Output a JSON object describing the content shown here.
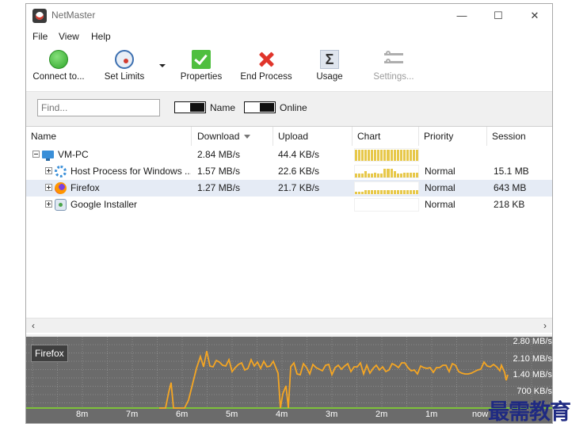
{
  "app": {
    "title": "NetMaster"
  },
  "window_controls": {
    "minimize": "—",
    "maximize": "☐",
    "close": "✕"
  },
  "menu": [
    "File",
    "View",
    "Help"
  ],
  "toolbar": [
    {
      "label": "Connect to...",
      "icon": "connect-icon",
      "enabled": true
    },
    {
      "label": "Set Limits",
      "icon": "gauge-icon",
      "enabled": true
    },
    {
      "label": "Properties",
      "icon": "check-icon",
      "enabled": true
    },
    {
      "label": "End Process",
      "icon": "end-process-icon",
      "enabled": true
    },
    {
      "label": "Usage",
      "icon": "sigma-icon",
      "enabled": true
    },
    {
      "label": "Settings...",
      "icon": "settings-icon",
      "enabled": false
    }
  ],
  "filter": {
    "find_placeholder": "Find...",
    "toggle_name_label": "Name",
    "toggle_online_label": "Online"
  },
  "columns": [
    "Name",
    "Download",
    "Upload",
    "Chart",
    "Priority",
    "Session"
  ],
  "sort": {
    "column": "Download",
    "direction": "descending"
  },
  "rows": [
    {
      "name": "VM-PC",
      "download": "2.84 MB/s",
      "upload": "44.4 KB/s",
      "priority": "",
      "session": "",
      "icon": "pc-icon",
      "level": 0,
      "expander": "minus",
      "selected": false,
      "chart": [
        0.9,
        0.9,
        0.9,
        0.9,
        0.9,
        0.9,
        0.9,
        0.9,
        0.9,
        0.9,
        0.9,
        0.9,
        0.9,
        0.9,
        0.9,
        0.9,
        0.9,
        0.9,
        0.9,
        0.9
      ]
    },
    {
      "name": "Host Process for Windows ...",
      "download": "1.57 MB/s",
      "upload": "22.6 KB/s",
      "priority": "Normal",
      "session": "15.1 MB",
      "icon": "cog-icon",
      "level": 1,
      "expander": "plus",
      "selected": false,
      "chart": [
        0.3,
        0.3,
        0.3,
        0.5,
        0.3,
        0.3,
        0.4,
        0.3,
        0.3,
        0.7,
        0.7,
        0.7,
        0.5,
        0.3,
        0.3,
        0.4,
        0.4,
        0.4,
        0.4,
        0.4
      ]
    },
    {
      "name": "Firefox",
      "download": "1.27 MB/s",
      "upload": "21.7 KB/s",
      "priority": "Normal",
      "session": "643 MB",
      "icon": "firefox-icon",
      "level": 1,
      "expander": "plus",
      "selected": true,
      "chart": [
        0.2,
        0.2,
        0.2,
        0.3,
        0.3,
        0.3,
        0.3,
        0.3,
        0.3,
        0.3,
        0.3,
        0.3,
        0.3,
        0.3,
        0.3,
        0.3,
        0.3,
        0.3,
        0.3,
        0.3
      ]
    },
    {
      "name": "Google Installer",
      "download": "",
      "upload": "",
      "priority": "Normal",
      "session": "218 KB",
      "icon": "installer-icon",
      "level": 1,
      "expander": "plus",
      "selected": false,
      "chart": []
    }
  ],
  "graph": {
    "label": "Firefox",
    "y_labels": [
      "2.80 MB/s",
      "2.10 MB/s",
      "1.40 MB/s",
      "700 KB/s"
    ],
    "x_labels": [
      "8m",
      "7m",
      "6m",
      "5m",
      "4m",
      "3m",
      "2m",
      "1m",
      "now"
    ],
    "line_color": "#f5a623",
    "baseline_color": "#7ec23a",
    "background_color": "#6b6b6b"
  },
  "watermark": "最需教育"
}
